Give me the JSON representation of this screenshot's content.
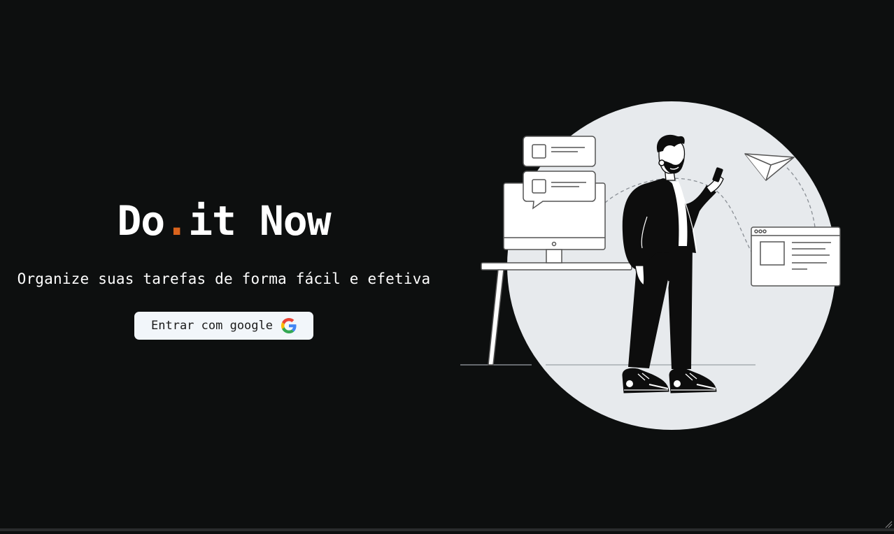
{
  "brand": {
    "part1": "Do",
    "dot": ".",
    "part2": "it Now",
    "accent_color": "#d9631d"
  },
  "hero": {
    "tagline": "Organize suas tarefas de forma fácil e efetiva"
  },
  "login": {
    "button_label": "Entrar com google",
    "icon": "google-icon"
  },
  "illustration": {
    "description_icon": "person-with-phone-illustration"
  },
  "colors": {
    "background": "#0d0f0f",
    "button_bg": "#f2f6fa",
    "circle": "#e7eaed"
  }
}
